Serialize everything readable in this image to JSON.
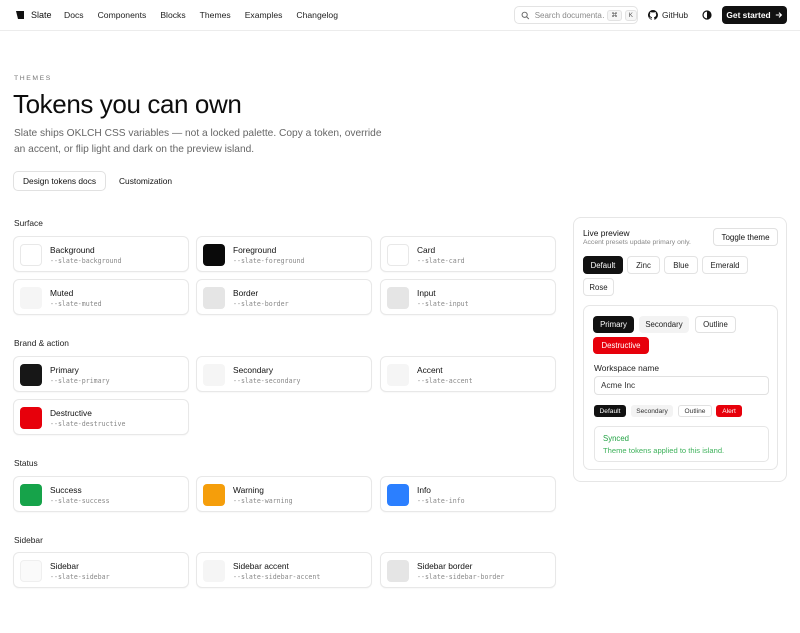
{
  "header": {
    "brand": "Slate",
    "nav": [
      "Docs",
      "Components",
      "Blocks",
      "Themes",
      "Examples",
      "Changelog"
    ],
    "search_placeholder": "Search documenta…",
    "kbd": [
      "⌘",
      "K"
    ],
    "github_label": "GitHub",
    "cta_label": "Get started"
  },
  "hero": {
    "eyebrow": "THEMES",
    "title": "Tokens you can own",
    "subtitle": "Slate ships OKLCH CSS variables — not a locked palette. Copy a token, override an accent, or flip light and dark on the preview island.",
    "primary_link": "Design tokens docs",
    "secondary_link": "Customization"
  },
  "sections": [
    {
      "label": "Surface",
      "tokens": [
        {
          "name": "Background",
          "var": "--slate-background",
          "color": "#ffffff"
        },
        {
          "name": "Foreground",
          "var": "--slate-foreground",
          "color": "#0a0a0a"
        },
        {
          "name": "Card",
          "var": "--slate-card",
          "color": "#ffffff"
        },
        {
          "name": "Muted",
          "var": "--slate-muted",
          "color": "#f5f5f5"
        },
        {
          "name": "Border",
          "var": "--slate-border",
          "color": "#e5e5e5"
        },
        {
          "name": "Input",
          "var": "--slate-input",
          "color": "#e5e5e5"
        }
      ]
    },
    {
      "label": "Brand & action",
      "tokens": [
        {
          "name": "Primary",
          "var": "--slate-primary",
          "color": "#171717"
        },
        {
          "name": "Secondary",
          "var": "--slate-secondary",
          "color": "#f5f5f5"
        },
        {
          "name": "Accent",
          "var": "--slate-accent",
          "color": "#f5f5f5"
        },
        {
          "name": "Destructive",
          "var": "--slate-destructive",
          "color": "#e7000b"
        }
      ]
    },
    {
      "label": "Status",
      "tokens": [
        {
          "name": "Success",
          "var": "--slate-success",
          "color": "#16a34a"
        },
        {
          "name": "Warning",
          "var": "--slate-warning",
          "color": "#f59e0b"
        },
        {
          "name": "Info",
          "var": "--slate-info",
          "color": "#2b7fff"
        }
      ]
    },
    {
      "label": "Sidebar",
      "tokens": [
        {
          "name": "Sidebar",
          "var": "--slate-sidebar",
          "color": "#fafafa"
        },
        {
          "name": "Sidebar accent",
          "var": "--slate-sidebar-accent",
          "color": "#f5f5f5"
        },
        {
          "name": "Sidebar border",
          "var": "--slate-sidebar-border",
          "color": "#e5e5e5"
        }
      ]
    }
  ],
  "preview": {
    "title": "Live preview",
    "subtitle": "Accent presets update primary only.",
    "toggle_label": "Toggle theme",
    "presets": [
      "Default",
      "Zinc",
      "Blue",
      "Emerald",
      "Rose"
    ],
    "active_preset": "Default",
    "buttons": {
      "primary": "Primary",
      "secondary": "Secondary",
      "outline": "Outline",
      "destructive": "Destructive"
    },
    "workspace_label": "Workspace name",
    "workspace_value": "Acme Inc",
    "badges": {
      "default": "Default",
      "secondary": "Secondary",
      "outline": "Outline",
      "alert": "Alert"
    },
    "alert_title": "Synced",
    "alert_desc": "Theme tokens applied to this island."
  },
  "colors": {
    "primary": "#111111",
    "destructive": "#e7000b",
    "success_text": "#22a344"
  }
}
